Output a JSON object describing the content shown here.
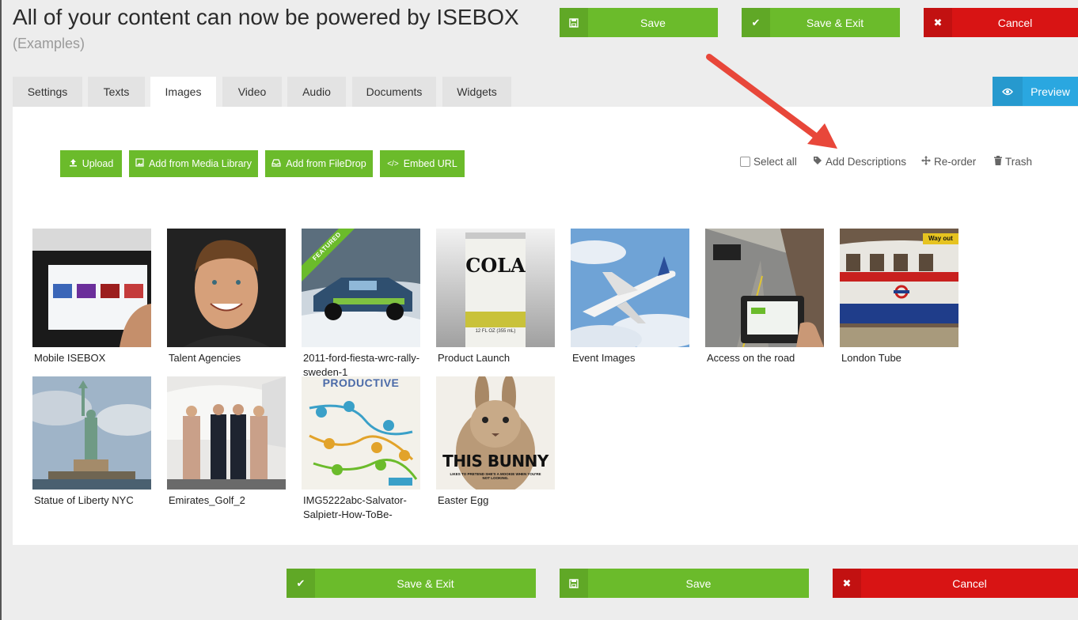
{
  "header": {
    "title": "All of your content can now be powered by ISEBOX",
    "subtitle": "(Examples)"
  },
  "top_actions": {
    "save": "Save",
    "save_exit": "Save & Exit",
    "cancel": "Cancel"
  },
  "tabs": [
    {
      "label": "Settings",
      "active": false
    },
    {
      "label": "Texts",
      "active": false
    },
    {
      "label": "Images",
      "active": true
    },
    {
      "label": "Video",
      "active": false
    },
    {
      "label": "Audio",
      "active": false
    },
    {
      "label": "Documents",
      "active": false
    },
    {
      "label": "Widgets",
      "active": false
    }
  ],
  "preview": {
    "label": "Preview"
  },
  "add_buttons": {
    "upload": "Upload",
    "media_library": "Add from Media Library",
    "filedrop": "Add from FileDrop",
    "embed": "Embed URL"
  },
  "tools": {
    "select_all": "Select all",
    "add_descriptions": "Add Descriptions",
    "reorder": "Re-order",
    "trash": "Trash"
  },
  "images": [
    {
      "caption": "Mobile ISEBOX",
      "featured": false
    },
    {
      "caption": "Talent Agencies",
      "featured": false
    },
    {
      "caption": "2011-ford-fiesta-wrc-rally-sweden-1",
      "featured": true,
      "badge": "FEATURED"
    },
    {
      "caption": "Product Launch",
      "featured": false,
      "thumb_text": "COLA",
      "thumb_subtext": "12 FL OZ (355 mL)"
    },
    {
      "caption": "Event Images",
      "featured": false
    },
    {
      "caption": "Access on the road",
      "featured": false
    },
    {
      "caption": "London Tube",
      "featured": false,
      "thumb_text": "Way out"
    },
    {
      "caption": "Statue of Liberty NYC",
      "featured": false
    },
    {
      "caption": "Emirates_Golf_2",
      "featured": false
    },
    {
      "caption": "IMG5222abc-Salvator-Salpietr-How-ToBe-",
      "featured": false,
      "thumb_text": "PRODUCTIVE"
    },
    {
      "caption": "Easter Egg",
      "featured": false,
      "thumb_text": "THIS BUNNY",
      "thumb_subtext": "LIKES TO PRETEND SHE'S A MOOKIE WHEN YOU'RE NOT LOOKING."
    }
  ],
  "bottom_actions": {
    "save_exit": "Save & Exit",
    "save": "Save",
    "cancel": "Cancel"
  },
  "colors": {
    "green": "#6bbb2b",
    "red": "#d81414",
    "blue": "#2aa7e0",
    "arrow": "#e8473a"
  }
}
